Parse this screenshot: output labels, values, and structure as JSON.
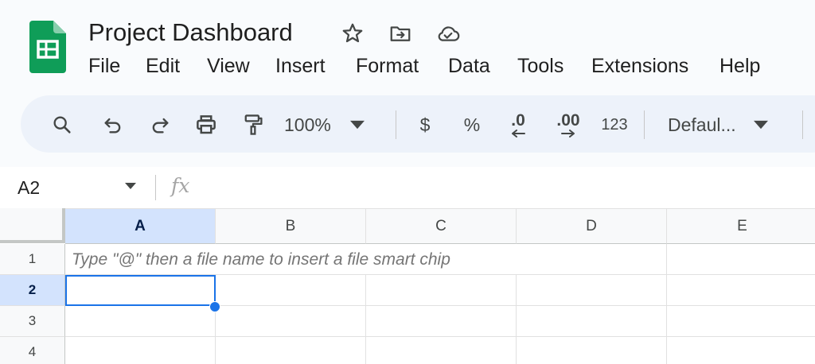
{
  "document": {
    "title": "Project Dashboard"
  },
  "menu": [
    "File",
    "Edit",
    "View",
    "Insert",
    "Format",
    "Data",
    "Tools",
    "Extensions",
    "Help"
  ],
  "toolbar": {
    "zoom": "100%",
    "currency": "$",
    "percent": "%",
    "decrease_decimal": ".0",
    "increase_decimal": ".00",
    "more_formats": "123",
    "font": "Defaul..."
  },
  "formula_bar": {
    "cell_ref": "A2",
    "fx_label": "fx",
    "value": ""
  },
  "grid": {
    "columns": [
      "A",
      "B",
      "C",
      "D",
      "E"
    ],
    "rows": [
      "1",
      "2",
      "3",
      "4"
    ],
    "active_column": "A",
    "active_row": "2",
    "hint_text": "Type \"@\" then a file name to insert a file smart chip"
  },
  "colors": {
    "sheets_green": "#0f9d58",
    "selection_blue": "#1a73e8",
    "active_header": "#d3e3fd",
    "toolbar_bg": "#edf2fa"
  },
  "icons": {
    "title": [
      "star-icon",
      "move-to-folder-icon",
      "cloud-saved-icon"
    ],
    "toolbar": [
      "search-icon",
      "undo-icon",
      "redo-icon",
      "print-icon",
      "paint-format-icon",
      "dropdown-caret-icon"
    ]
  }
}
